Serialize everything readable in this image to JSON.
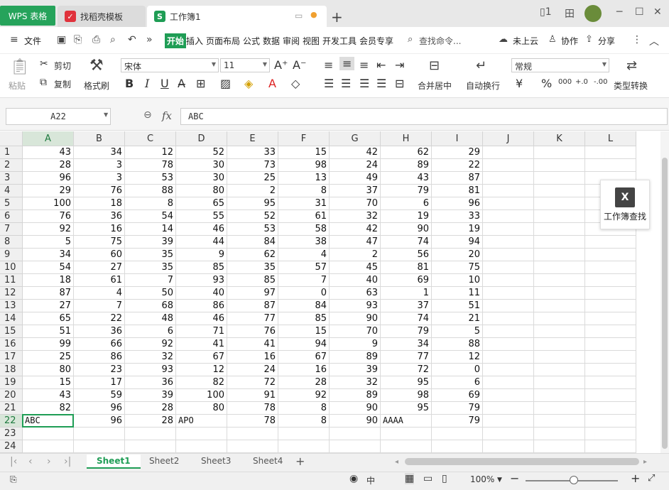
{
  "titlebar": {
    "tabs": [
      {
        "label": "WPS 表格"
      },
      {
        "label": "找稻壳模板"
      },
      {
        "label": "工作簿1"
      }
    ],
    "new_tab": "+",
    "window_buttons": {
      "minimize": "─",
      "maximize": "☐",
      "close": "✕",
      "layout": "田"
    }
  },
  "menubar": {
    "file_label": "文件",
    "start_label": "开始",
    "items": [
      "插入",
      "页面布局",
      "公式",
      "数据",
      "审阅",
      "视图",
      "开发工具",
      "会员专享"
    ],
    "search_placeholder": "查找命令...",
    "cloud_label": "未上云",
    "collab_label": "协作",
    "share_label": "分享",
    "more_label": "⋮",
    "collapse_label": "︿"
  },
  "ribbon": {
    "paste_label": "粘贴",
    "cut_label": "剪切",
    "copy_label": "复制",
    "format_painter_label": "格式刷",
    "font_name": "宋体",
    "font_size": "11",
    "bold": "B",
    "italic": "I",
    "underline": "U",
    "merge_label": "合并居中",
    "wrap_label": "自动换行",
    "number_format": "常规",
    "currency": "¥",
    "percent": "%",
    "thousands": "000",
    "inc_decimal": "+.0",
    "dec_decimal": "-.00",
    "type_convert_label": "类型转换"
  },
  "formula_bar": {
    "name_box": "A22",
    "fx": "fx",
    "content": "ABC"
  },
  "grid": {
    "columns": [
      "A",
      "B",
      "C",
      "D",
      "E",
      "F",
      "G",
      "H",
      "I",
      "J",
      "K",
      "L"
    ],
    "rows": [
      [
        "43",
        "34",
        "12",
        "52",
        "33",
        "15",
        "42",
        "62",
        "29"
      ],
      [
        "28",
        "3",
        "78",
        "30",
        "73",
        "98",
        "24",
        "89",
        "22"
      ],
      [
        "96",
        "3",
        "53",
        "30",
        "25",
        "13",
        "49",
        "43",
        "87"
      ],
      [
        "29",
        "76",
        "88",
        "80",
        "2",
        "8",
        "37",
        "79",
        "81"
      ],
      [
        "100",
        "18",
        "8",
        "65",
        "95",
        "31",
        "70",
        "6",
        "96"
      ],
      [
        "76",
        "36",
        "54",
        "55",
        "52",
        "61",
        "32",
        "19",
        "33"
      ],
      [
        "92",
        "16",
        "14",
        "46",
        "53",
        "58",
        "42",
        "90",
        "19"
      ],
      [
        "5",
        "75",
        "39",
        "44",
        "84",
        "38",
        "47",
        "74",
        "94"
      ],
      [
        "34",
        "60",
        "35",
        "9",
        "62",
        "4",
        "2",
        "56",
        "20"
      ],
      [
        "54",
        "27",
        "35",
        "85",
        "35",
        "57",
        "45",
        "81",
        "75"
      ],
      [
        "18",
        "61",
        "7",
        "93",
        "85",
        "7",
        "40",
        "69",
        "10"
      ],
      [
        "87",
        "4",
        "50",
        "40",
        "97",
        "0",
        "63",
        "1",
        "11"
      ],
      [
        "27",
        "7",
        "68",
        "86",
        "87",
        "84",
        "93",
        "37",
        "51"
      ],
      [
        "65",
        "22",
        "48",
        "46",
        "77",
        "85",
        "90",
        "74",
        "21"
      ],
      [
        "51",
        "36",
        "6",
        "71",
        "76",
        "15",
        "70",
        "79",
        "5"
      ],
      [
        "99",
        "66",
        "92",
        "41",
        "41",
        "94",
        "9",
        "34",
        "88"
      ],
      [
        "25",
        "86",
        "32",
        "67",
        "16",
        "67",
        "89",
        "77",
        "12"
      ],
      [
        "80",
        "23",
        "93",
        "12",
        "24",
        "16",
        "39",
        "72",
        "0"
      ],
      [
        "15",
        "17",
        "36",
        "82",
        "72",
        "28",
        "32",
        "95",
        "6"
      ],
      [
        "43",
        "59",
        "39",
        "100",
        "91",
        "92",
        "89",
        "98",
        "69"
      ],
      [
        "82",
        "96",
        "28",
        "80",
        "78",
        "8",
        "90",
        "95",
        "79"
      ],
      [
        "ABC",
        "96",
        "28",
        "APO",
        "78",
        "8",
        "90",
        "AAAA",
        "79"
      ],
      [],
      []
    ],
    "row_numbers": [
      "1",
      "2",
      "3",
      "4",
      "5",
      "6",
      "7",
      "8",
      "9",
      "10",
      "11",
      "12",
      "13",
      "14",
      "15",
      "16",
      "17",
      "18",
      "19",
      "20",
      "21",
      "22",
      "23",
      "24"
    ],
    "selected_cell": "A22"
  },
  "find_panel": {
    "label": "工作簿查找",
    "icon": "X"
  },
  "sheets": {
    "tabs": [
      "Sheet1",
      "Sheet2",
      "Sheet3",
      "Sheet4"
    ],
    "active": "Sheet1",
    "add": "+"
  },
  "statusbar": {
    "zoom": "100%",
    "lang": "中"
  },
  "colors": {
    "accent": "#1f9d55",
    "wps_green": "#26a35b",
    "template_red": "#e0323c"
  }
}
